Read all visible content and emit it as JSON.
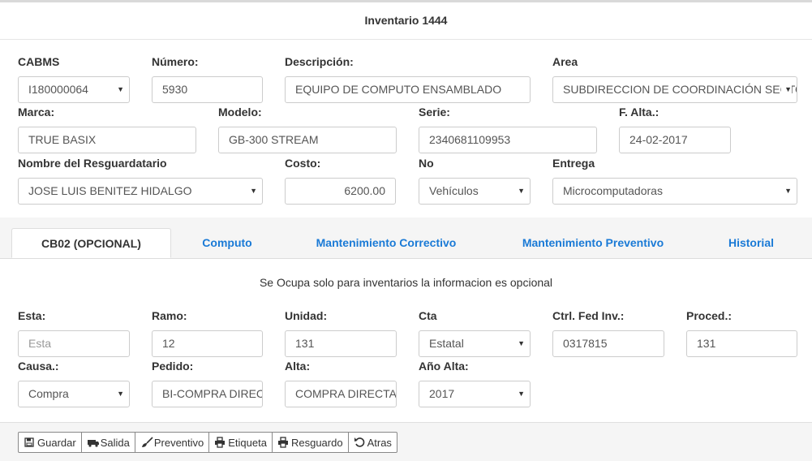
{
  "header": {
    "title": "Inventario 1444"
  },
  "general": {
    "cabms": {
      "label": "CABMS",
      "value": "I180000064"
    },
    "numero": {
      "label": "Número:",
      "value": "5930"
    },
    "descripcion": {
      "label": "Descripción:",
      "value": "EQUIPO DE COMPUTO ENSAMBLADO"
    },
    "area": {
      "label": "Area",
      "value": "SUBDIRECCION DE COORDINACIÓN SECTORIAL"
    },
    "marca": {
      "label": "Marca:",
      "value": "TRUE BASIX"
    },
    "modelo": {
      "label": "Modelo:",
      "value": "GB-300 STREAM"
    },
    "serie": {
      "label": "Serie:",
      "value": "2340681109953"
    },
    "falta": {
      "label": "F. Alta.:",
      "value": "24-02-2017"
    },
    "resguardatario": {
      "label": "Nombre del Resguardatario",
      "value": "JOSE LUIS BENITEZ HIDALGO"
    },
    "costo": {
      "label": "Costo:",
      "value": "6200.00"
    },
    "no": {
      "label": "No",
      "value": "Vehículos"
    },
    "entrega": {
      "label": "Entrega",
      "value": "Microcomputadoras"
    }
  },
  "tabs": [
    {
      "label": "CB02 (OPCIONAL)",
      "active": true
    },
    {
      "label": "Computo"
    },
    {
      "label": "Mantenimiento Correctivo"
    },
    {
      "label": "Mantenimiento Preventivo"
    },
    {
      "label": "Historial"
    }
  ],
  "cb02": {
    "note": "Se Ocupa solo para inventarios la informacion es opcional",
    "esta": {
      "label": "Esta:",
      "placeholder": "Esta"
    },
    "ramo": {
      "label": "Ramo:",
      "value": "12"
    },
    "unidad": {
      "label": "Unidad:",
      "value": "131"
    },
    "cta": {
      "label": "Cta",
      "value": "Estatal"
    },
    "ctrl_fed_inv": {
      "label": "Ctrl. Fed Inv.:",
      "value": "0317815"
    },
    "proced": {
      "label": "Proced.:",
      "value": "131"
    },
    "causa": {
      "label": "Causa.:",
      "value": "Compra"
    },
    "pedido": {
      "label": "Pedido:",
      "value": "BI-COMPRA DIRECTA"
    },
    "alta": {
      "label": "Alta:",
      "value": "COMPRA DIRECTA"
    },
    "anio_alta": {
      "label": "Año Alta:",
      "value": "2017"
    }
  },
  "footer": {
    "buttons": [
      {
        "label": "Guardar",
        "icon": "save-icon"
      },
      {
        "label": "Salida",
        "icon": "truck-icon"
      },
      {
        "label": "Preventivo",
        "icon": "brush-icon"
      },
      {
        "label": "Etiqueta",
        "icon": "print-icon"
      },
      {
        "label": "Resguardo",
        "icon": "print-icon"
      },
      {
        "label": "Atras",
        "icon": "undo-icon"
      }
    ]
  },
  "colors": {
    "accent": "#1a7ad6",
    "border": "#cccccc",
    "band": "#f5f5f5"
  }
}
